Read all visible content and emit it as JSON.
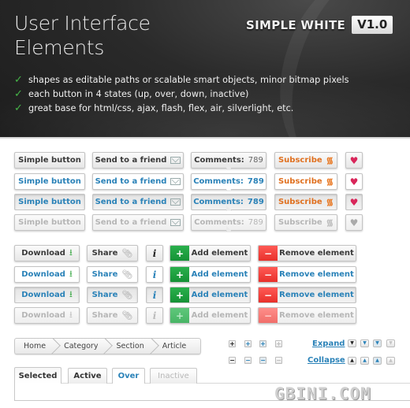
{
  "header": {
    "title_line1": "User Interface",
    "title_line2": "Elements",
    "brand": "SIMPLE WHITE",
    "version": "V1.0",
    "check_icon": "checkmark-icon",
    "features": [
      "shapes as editable paths or scalable smart objects, minor bitmap pixels",
      "each button in 4 states (up, over, down, inactive)",
      "great base for html/css, ajax, flash, flex, air, silverlight, etc."
    ]
  },
  "states": [
    "up",
    "over",
    "down",
    "inactive"
  ],
  "buttons": {
    "simple": "Simple button",
    "send": "Send to a friend",
    "comments_label": "Comments:",
    "comments_count": "789",
    "subscribe": "Subscribe",
    "download": "Download",
    "share": "Share",
    "info": "i",
    "add": "Add element",
    "add_sign": "+",
    "remove": "Remove element",
    "remove_sign": "−"
  },
  "icons": {
    "rss": "Ƨ",
    "heart": "♥",
    "download": "⭳",
    "clip": "⌐"
  },
  "breadcrumb": [
    "Home",
    "Category",
    "Section",
    "Article"
  ],
  "mini": {
    "plus": "+",
    "minus": "−",
    "expand": "Expand",
    "collapse": "Collapse",
    "down_arrow": "▼",
    "up_arrow": "▲"
  },
  "tabs": [
    {
      "label": "Selected",
      "state": "selected"
    },
    {
      "label": "Active",
      "state": "active"
    },
    {
      "label": "Over",
      "state": "over"
    },
    {
      "label": "Inactive",
      "state": "inactive"
    }
  ],
  "watermark": "GBINI.COM",
  "colors": {
    "accent_blue": "#2a82b8",
    "subscribe_orange": "#e0701f",
    "add_green": "#1aa040",
    "remove_red": "#f0403b",
    "heart_red": "#d9265a"
  }
}
